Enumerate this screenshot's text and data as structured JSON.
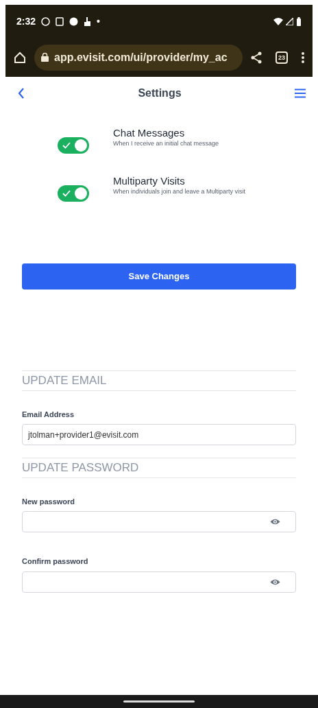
{
  "status_bar": {
    "time": "2:32",
    "dot": "•"
  },
  "browser": {
    "url": "app.evisit.com/ui/provider/my_ac",
    "tab_count": "23"
  },
  "header": {
    "title": "Settings"
  },
  "notifications": [
    {
      "title": "Chat Messages",
      "description": "When I receive an initial chat message",
      "on": true
    },
    {
      "title": "Multiparty Visits",
      "description": "When individuals join and leave a Multiparty visit",
      "on": true
    }
  ],
  "save_button": "Save Changes",
  "sections": [
    {
      "heading": "UPDATE EMAIL",
      "fields": [
        {
          "label": "Email Address",
          "value": "jtolman+provider1@evisit.com",
          "kind": "text"
        }
      ]
    },
    {
      "heading": "UPDATE PASSWORD",
      "fields": [
        {
          "label": "New password",
          "kind": "password"
        },
        {
          "label": "Confirm password",
          "kind": "password"
        }
      ]
    }
  ]
}
